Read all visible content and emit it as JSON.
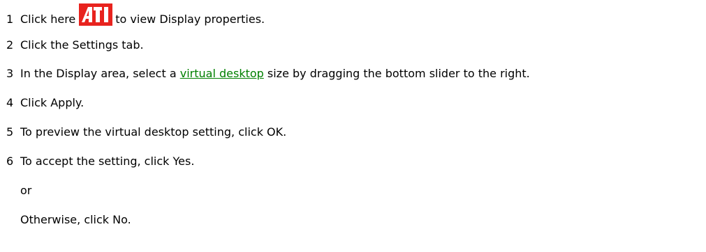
{
  "steps": [
    {
      "num": "1",
      "before": "Click here",
      "after": "to view Display properties.",
      "icon": "ati-logo-icon"
    },
    {
      "num": "2",
      "text": "Click the Settings tab."
    },
    {
      "num": "3",
      "before": "In the Display area, select a",
      "link": "virtual desktop",
      "after": "size by dragging the bottom slider to the right."
    },
    {
      "num": "4",
      "text": "Click Apply."
    },
    {
      "num": "5",
      "text": "To preview the virtual desktop setting, click OK."
    },
    {
      "num": "6",
      "text": "To accept the setting, click Yes."
    }
  ],
  "or_text": "or",
  "otherwise_text": "Otherwise, click No.",
  "colors": {
    "link": "#008000",
    "logo_red": "#e8231e",
    "logo_white": "#ffffff"
  }
}
